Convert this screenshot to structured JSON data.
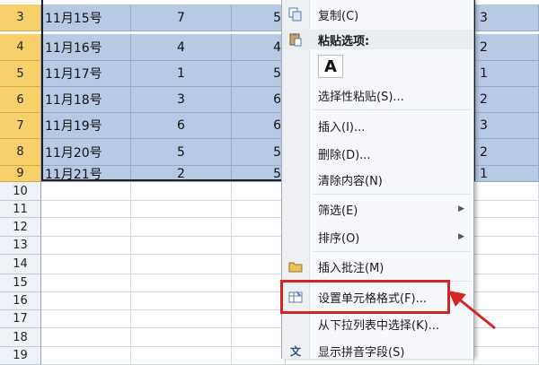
{
  "rows": [
    {
      "num": "3",
      "date": "11月15号",
      "c": "7",
      "d": "5",
      "f": "3",
      "selected": true
    },
    {
      "num": "4",
      "date": "11月16号",
      "c": "4",
      "d": "4",
      "f": "2",
      "selected": true
    },
    {
      "num": "5",
      "date": "11月17号",
      "c": "1",
      "d": "5",
      "f": "1",
      "selected": true
    },
    {
      "num": "6",
      "date": "11月18号",
      "c": "3",
      "d": "6",
      "f": "2",
      "selected": true
    },
    {
      "num": "7",
      "date": "11月19号",
      "c": "6",
      "d": "6",
      "f": "3",
      "selected": true
    },
    {
      "num": "8",
      "date": "11月20号",
      "c": "5",
      "d": "5",
      "f": "2",
      "selected": true
    },
    {
      "num": "9",
      "date": "11月21号",
      "c": "2",
      "d": "5",
      "f": "1",
      "selected": true
    },
    {
      "num": "10",
      "date": "",
      "c": "",
      "d": "",
      "f": "",
      "selected": false
    },
    {
      "num": "11",
      "date": "",
      "c": "",
      "d": "",
      "f": "",
      "selected": false
    },
    {
      "num": "12",
      "date": "",
      "c": "",
      "d": "",
      "f": "",
      "selected": false
    },
    {
      "num": "13",
      "date": "",
      "c": "",
      "d": "",
      "f": "",
      "selected": false
    },
    {
      "num": "14",
      "date": "",
      "c": "",
      "d": "",
      "f": "",
      "selected": false
    },
    {
      "num": "15",
      "date": "",
      "c": "",
      "d": "",
      "f": "",
      "selected": false
    },
    {
      "num": "16",
      "date": "",
      "c": "",
      "d": "",
      "f": "",
      "selected": false
    },
    {
      "num": "17",
      "date": "",
      "c": "",
      "d": "",
      "f": "",
      "selected": false
    },
    {
      "num": "18",
      "date": "",
      "c": "",
      "d": "",
      "f": "",
      "selected": false
    },
    {
      "num": "19",
      "date": "",
      "c": "",
      "d": "",
      "f": "",
      "selected": false
    }
  ],
  "menu": {
    "copy": "复制(C)",
    "paste_options_header": "粘贴选项:",
    "paste_icon_letter": "A",
    "paste_special": "选择性粘贴(S)...",
    "insert": "插入(I)...",
    "delete": "删除(D)...",
    "clear_contents": "清除内容(N)",
    "filter": "筛选(E)",
    "sort": "排序(O)",
    "insert_comment": "插入批注(M)",
    "format_cells": "设置单元格格式(F)...",
    "pick_from_list": "从下拉列表中选择(K)...",
    "show_phonetic": "显示拼音字段(S)",
    "submenu_arrow": "▶",
    "phonetic_icon_glyph": "文"
  },
  "colors": {
    "selection": "#b8c9e4",
    "row_header_selected": "#f7cf6b",
    "highlight": "#d42525"
  }
}
